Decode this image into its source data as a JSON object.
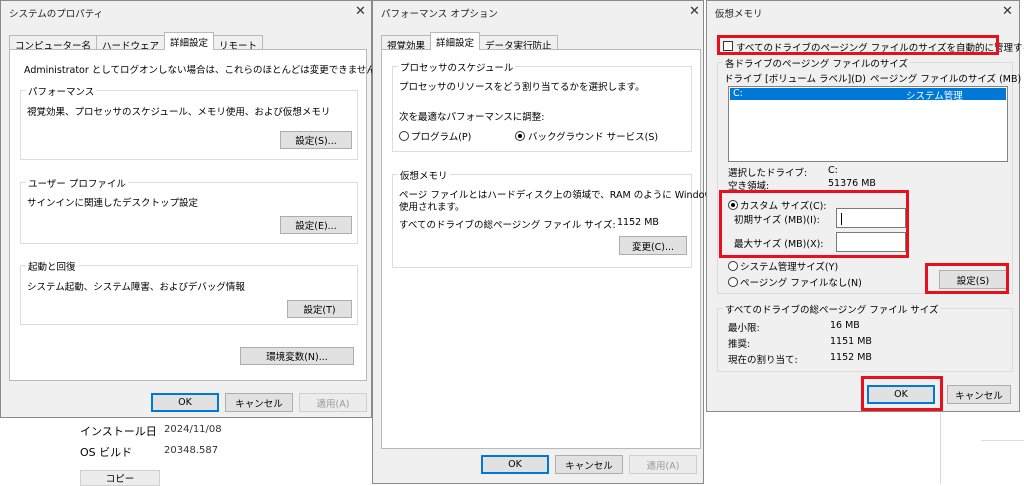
{
  "sys": {
    "title": "システムのプロパティ",
    "tabs": [
      "コンピューター名",
      "ハードウェア",
      "詳細設定",
      "リモート"
    ],
    "admin_note": "Administrator としてログオンしない場合は、これらのほとんどは変更できません。",
    "perf": {
      "label": "パフォーマンス",
      "desc": "視覚効果、プロセッサのスケジュール、メモリ使用、および仮想メモリ",
      "btn": "設定(S)..."
    },
    "profile": {
      "label": "ユーザー プロファイル",
      "desc": "サインインに関連したデスクトップ設定",
      "btn": "設定(E)..."
    },
    "startup": {
      "label": "起動と回復",
      "desc": "システム起動、システム障害、およびデバッグ情報",
      "btn": "設定(T)"
    },
    "env_btn": "環境変数(N)...",
    "ok": "OK",
    "cancel": "キャンセル",
    "apply": "適用(A)"
  },
  "bg": {
    "install_label": "インストール日",
    "install_value": "2024/11/08",
    "build_label": "OS ビルド",
    "build_value": "20348.587",
    "copy_btn": "コピー"
  },
  "perfopt": {
    "title": "パフォーマンス オプション",
    "tabs": [
      "視覚効果",
      "詳細設定",
      "データ実行防止"
    ],
    "sched": {
      "label": "プロセッサのスケジュール",
      "desc": "プロセッサのリソースをどう割り当てるかを選択します。",
      "adjust": "次を最適なパフォーマンスに調整:",
      "program": "プログラム(P)",
      "background": "バックグラウンド サービス(S)"
    },
    "vm": {
      "label": "仮想メモリ",
      "desc1": "ページ ファイルとはハードディスク上の領域で、RAM のように Windows で",
      "desc2": "使用されます。",
      "total_label": "すべてのドライブの総ページング ファイル サイズ:",
      "total_value": "1152 MB",
      "change_btn": "変更(C)..."
    },
    "ok": "OK",
    "cancel": "キャンセル",
    "apply": "適用(A)"
  },
  "vmem": {
    "title": "仮想メモリ",
    "auto_manage": "すべてのドライブのページング ファイルのサイズを自動的に管理する(A)",
    "group_label": "各ドライブのページング ファイルのサイズ",
    "col_drive": "ドライブ [ボリューム ラベル](D)",
    "col_size": "ページング ファイルのサイズ (MB)",
    "row_drive": "C:",
    "row_size": "システム管理",
    "selected_label": "選択したドライブ:",
    "selected_value": "C:",
    "free_label": "空き領域:",
    "free_value": "51376 MB",
    "custom": "カスタム サイズ(C):",
    "initial": "初期サイズ (MB)(I):",
    "max": "最大サイズ (MB)(X):",
    "system_managed": "システム管理サイズ(Y)",
    "no_paging": "ページング ファイルなし(N)",
    "set_btn": "設定(S)",
    "total_group": "すべてのドライブの総ページング ファイル サイズ",
    "min_label": "最小限:",
    "min_value": "16 MB",
    "rec_label": "推奨:",
    "rec_value": "1151 MB",
    "cur_label": "現在の割り当て:",
    "cur_value": "1152 MB",
    "ok": "OK",
    "cancel": "キャンセル"
  },
  "icons": {
    "close": "close-icon",
    "radio": "radio-button",
    "checkbox": "checkbox"
  },
  "colors": {
    "highlight": "#e8101a",
    "selection": "#0078d7",
    "dialog_bg": "#f0f0f0"
  }
}
